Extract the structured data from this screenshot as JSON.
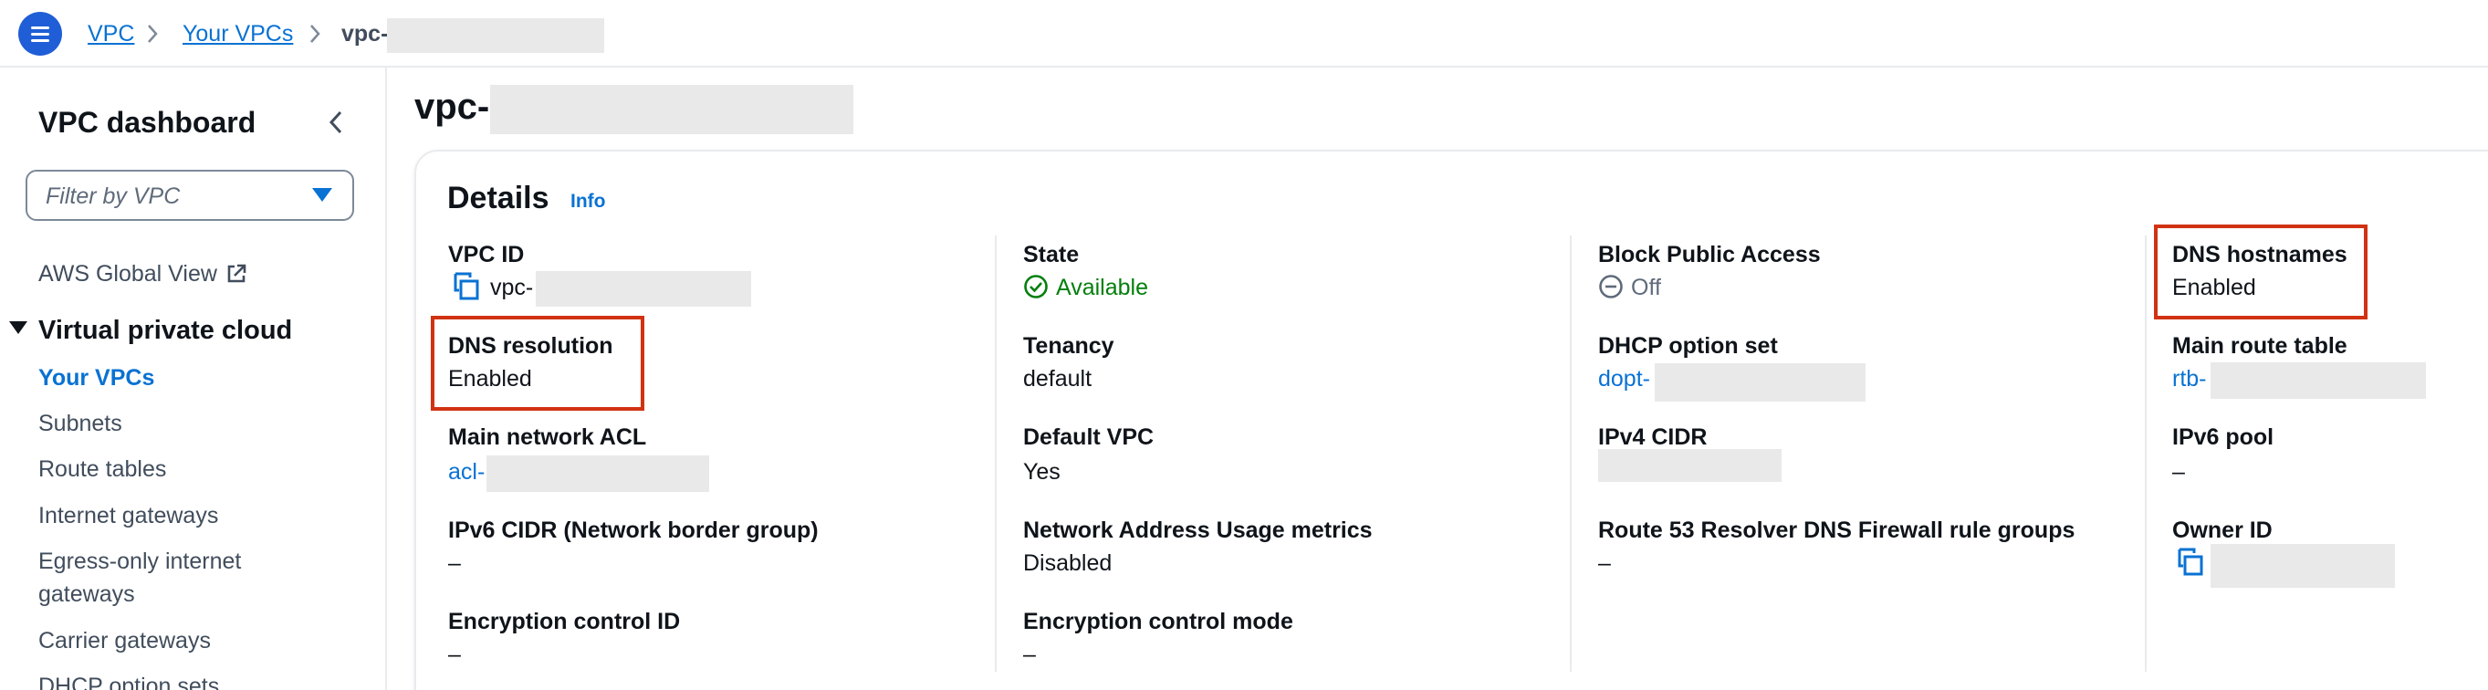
{
  "breadcrumb": {
    "items": [
      {
        "label": "VPC"
      },
      {
        "label": "Your VPCs"
      },
      {
        "label": "vpc-"
      }
    ]
  },
  "sidebar": {
    "title": "VPC dashboard",
    "filter_placeholder": "Filter by VPC",
    "global_view": "AWS Global View",
    "section": "Virtual private cloud",
    "items": [
      {
        "label": "Your VPCs"
      },
      {
        "label": "Subnets"
      },
      {
        "label": "Route tables"
      },
      {
        "label": "Internet gateways"
      },
      {
        "label": "Egress-only internet"
      },
      {
        "label": "gateways"
      },
      {
        "label": "Carrier gateways"
      },
      {
        "label": "DHCP option sets"
      }
    ]
  },
  "page": {
    "title": "vpc-"
  },
  "details": {
    "title": "Details",
    "info": "Info",
    "col1": {
      "vpc_id_label": "VPC ID",
      "vpc_id_value": "vpc-",
      "dns_resolution_label": "DNS resolution",
      "dns_resolution_value": "Enabled",
      "nacl_label": "Main network ACL",
      "nacl_value": "acl-",
      "ipv6_cidr_label": "IPv6 CIDR (Network border group)",
      "ipv6_cidr_value": "–",
      "enc_id_label": "Encryption control ID",
      "enc_id_value": "–"
    },
    "col2": {
      "state_label": "State",
      "state_value": "Available",
      "tenancy_label": "Tenancy",
      "tenancy_value": "default",
      "default_vpc_label": "Default VPC",
      "default_vpc_value": "Yes",
      "nau_label": "Network Address Usage metrics",
      "nau_value": "Disabled",
      "enc_mode_label": "Encryption control mode",
      "enc_mode_value": "–"
    },
    "col3": {
      "bpa_label": "Block Public Access",
      "bpa_value": "Off",
      "dhcp_label": "DHCP option set",
      "dhcp_value": "dopt-",
      "ipv4_label": "IPv4 CIDR",
      "r53_label": "Route 53 Resolver DNS Firewall rule groups",
      "r53_value": "–"
    },
    "col4": {
      "dns_hostnames_label": "DNS hostnames",
      "dns_hostnames_value": "Enabled",
      "route_table_label": "Main route table",
      "route_table_value": "rtb-",
      "ipv6_pool_label": "IPv6 pool",
      "ipv6_pool_value": "–",
      "owner_label": "Owner ID"
    }
  },
  "colors": {
    "link": "#0972d3",
    "available": "#037f0c",
    "highlight": "#d13212",
    "menu_button": "#1f5ed6"
  },
  "icons": {
    "menu": "hamburger-icon",
    "external": "external-link-icon",
    "copy": "copy-icon",
    "available": "check-circle-icon",
    "off": "minus-circle-icon"
  }
}
